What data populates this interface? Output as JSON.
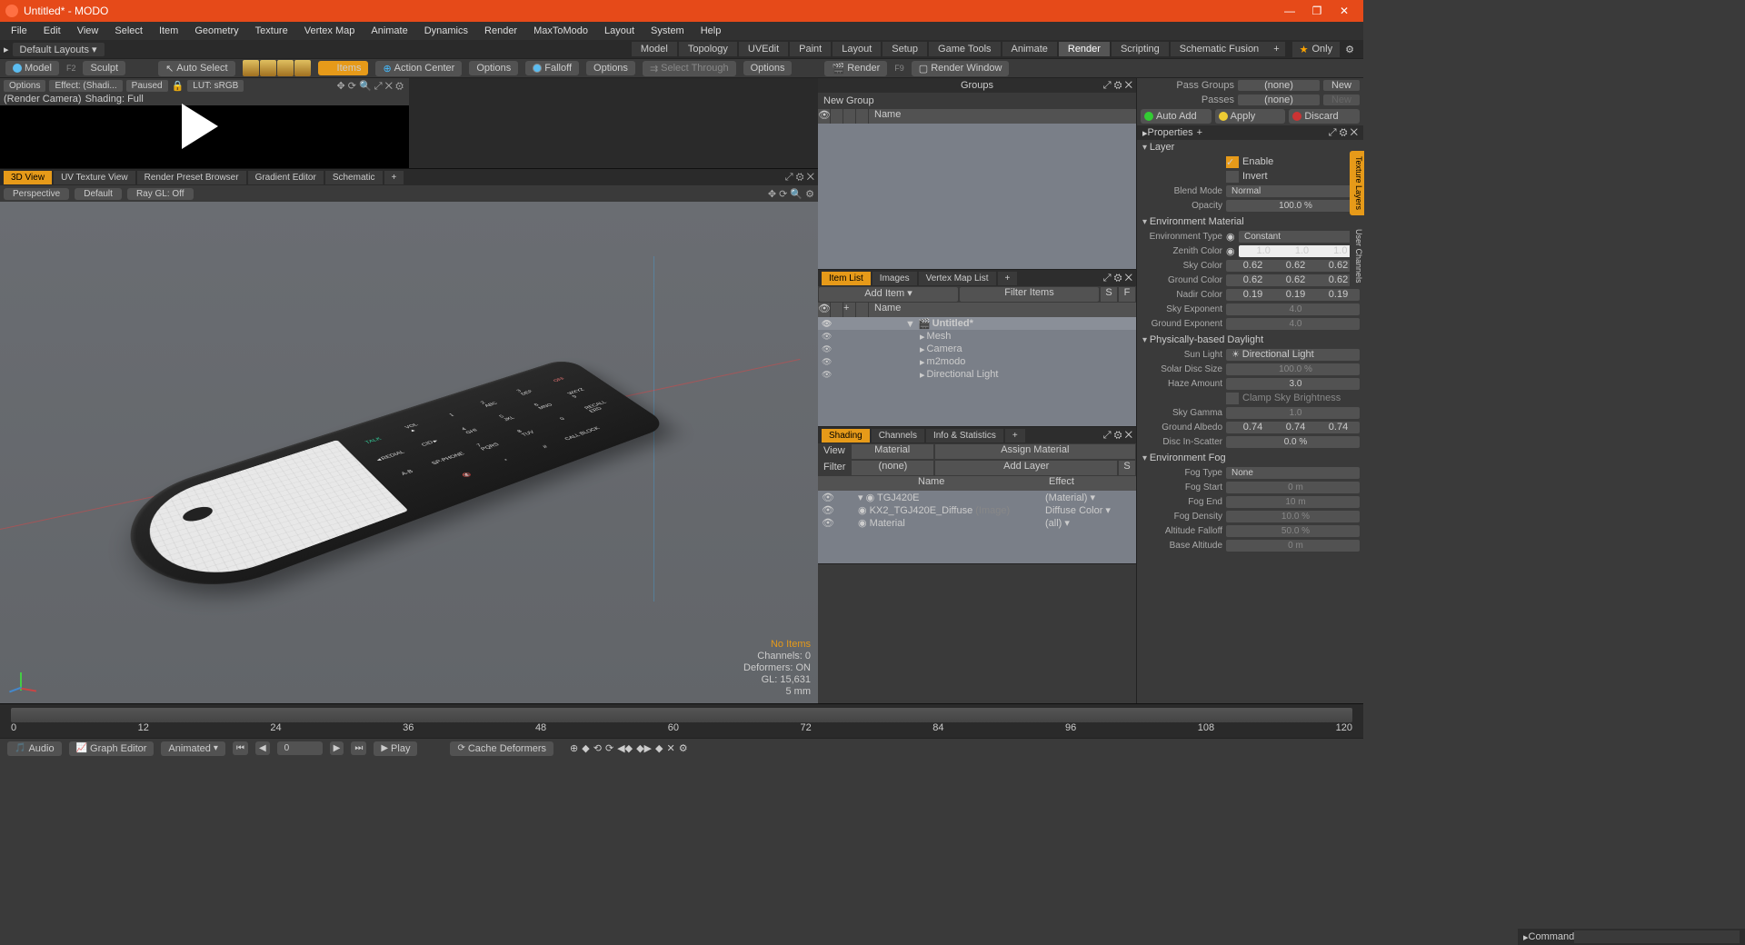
{
  "app": {
    "title": "Untitled* - MODO"
  },
  "window_controls": {
    "min": "—",
    "max": "❐",
    "close": "✕"
  },
  "menus": [
    "File",
    "Edit",
    "View",
    "Select",
    "Item",
    "Geometry",
    "Texture",
    "Vertex Map",
    "Animate",
    "Dynamics",
    "Render",
    "MaxToModo",
    "Layout",
    "System",
    "Help"
  ],
  "layout": {
    "label": "Default Layouts ▾",
    "tabs": [
      "Model",
      "Topology",
      "UVEdit",
      "Paint",
      "Layout",
      "Setup",
      "Game Tools",
      "Animate",
      "Render",
      "Scripting",
      "Schematic Fusion"
    ],
    "active": "Render",
    "only": "Only"
  },
  "toolbar": {
    "model": "Model",
    "model_key": "F2",
    "sculpt": "Sculpt",
    "autoselect": "Auto Select",
    "items": "Items",
    "actioncenter": "Action Center",
    "options1": "Options",
    "falloff": "Falloff",
    "options2": "Options",
    "selectthrough": "Select Through",
    "options3": "Options",
    "render": "Render",
    "render_key": "F9",
    "renderwindow": "Render Window"
  },
  "preview": {
    "options": "Options",
    "effect": "Effect: (Shadi...",
    "paused": "Paused",
    "lock": "🔒",
    "lut": "LUT: sRGB",
    "camera": "(Render Camera)",
    "shading": "Shading: Full"
  },
  "viewtabs": {
    "tabs": [
      "3D View",
      "UV Texture View",
      "Render Preset Browser",
      "Gradient Editor",
      "Schematic"
    ],
    "active": "3D View",
    "plus": "+"
  },
  "viewsub": {
    "persp": "Perspective",
    "default": "Default",
    "raygl": "Ray GL: Off"
  },
  "vpinfo": {
    "noitems": "No Items",
    "channels": "Channels: 0",
    "deformers": "Deformers: ON",
    "gl": "GL: 15,631",
    "scale": "5 mm"
  },
  "groups": {
    "title": "Groups",
    "newgroup": "New Group",
    "name": "Name"
  },
  "itemlist": {
    "tabs": [
      "Item List",
      "Images",
      "Vertex Map List"
    ],
    "active": "Item List",
    "plus": "+",
    "additem": "Add Item",
    "filter": "Filter Items",
    "s": "S",
    "f": "F",
    "name": "Name",
    "tree": [
      {
        "label": "Untitled*",
        "icon": "scene",
        "indent": 0,
        "sel": true
      },
      {
        "label": "Mesh",
        "icon": "mesh",
        "indent": 1
      },
      {
        "label": "Camera",
        "icon": "camera",
        "indent": 1
      },
      {
        "label": "m2modo",
        "icon": "group",
        "indent": 1
      },
      {
        "label": "Directional Light",
        "icon": "light",
        "indent": 1
      }
    ]
  },
  "shading": {
    "tabs": [
      "Shading",
      "Channels",
      "Info & Statistics"
    ],
    "active": "Shading",
    "plus": "+",
    "view": "View",
    "material": "Material",
    "assign": "Assign Material",
    "filter": "Filter",
    "none": "(none)",
    "addlayer": "Add Layer",
    "s": "S",
    "name": "Name",
    "effect": "Effect",
    "rows": [
      {
        "name": "TGJ420E",
        "effect": "(Material)",
        "mat": true
      },
      {
        "name": "KX2_TGJ420E_Diffuse",
        "hint": "(Image)",
        "effect": "Diffuse Color"
      },
      {
        "name": "Material",
        "effect": "(all)"
      }
    ]
  },
  "passes": {
    "passgroups": "Pass Groups",
    "none": "(none)",
    "new": "New",
    "passes": "Passes",
    "new2": "New"
  },
  "actions": {
    "autoadd": "Auto Add",
    "apply": "Apply",
    "discard": "Discard"
  },
  "props": {
    "title": "Properties",
    "layer": {
      "head": "Layer",
      "enable": "Enable",
      "invert": "Invert",
      "blend": "Blend Mode",
      "blendv": "Normal",
      "opac": "Opacity",
      "opacv": "100.0 %"
    },
    "env": {
      "head": "Environment Material",
      "type": "Environment Type",
      "typev": "Constant",
      "zenith": "Zenith Color",
      "zenithv": [
        "1.0",
        "1.0",
        "1.0"
      ],
      "sky": "Sky Color",
      "skyv": [
        "0.62",
        "0.62",
        "0.62"
      ],
      "ground": "Ground Color",
      "groundv": [
        "0.62",
        "0.62",
        "0.62"
      ],
      "nadir": "Nadir Color",
      "nadirv": [
        "0.19",
        "0.19",
        "0.19"
      ],
      "skyexp": "Sky Exponent",
      "skyexpv": "4.0",
      "groundexp": "Ground Exponent",
      "groundexpv": "4.0"
    },
    "daylight": {
      "head": "Physically-based Daylight",
      "sun": "Sun Light",
      "sunv": "Directional Light",
      "disc": "Solar Disc Size",
      "discv": "100.0 %",
      "haze": "Haze Amount",
      "hazev": "3.0",
      "clamp": "Clamp Sky Brightness",
      "gamma": "Sky Gamma",
      "gammav": "1.0",
      "albedo": "Ground Albedo",
      "albedov": [
        "0.74",
        "0.74",
        "0.74"
      ],
      "scatter": "Disc In-Scatter",
      "scatterv": "0.0 %"
    },
    "fog": {
      "head": "Environment Fog",
      "type": "Fog Type",
      "typev": "None",
      "start": "Fog Start",
      "startv": "0 m",
      "end": "Fog End",
      "endv": "10 m",
      "density": "Fog Density",
      "densityv": "10.0 %",
      "falloff": "Altitude Falloff",
      "falloffv": "50.0 %",
      "base": "Base Altitude",
      "basev": "0 m"
    }
  },
  "sidetabs": {
    "t1": "Texture Layers",
    "t2": "User Channels"
  },
  "timeline": {
    "ticks": [
      "0",
      "12",
      "24",
      "36",
      "48",
      "60",
      "72",
      "84",
      "96",
      "108",
      "120"
    ],
    "end": "120"
  },
  "botbar": {
    "audio": "Audio",
    "graph": "Graph Editor",
    "animated": "Animated",
    "frame": "0",
    "play": "Play",
    "cache": "Cache Deformers"
  },
  "cmd": {
    "label": "Command"
  }
}
